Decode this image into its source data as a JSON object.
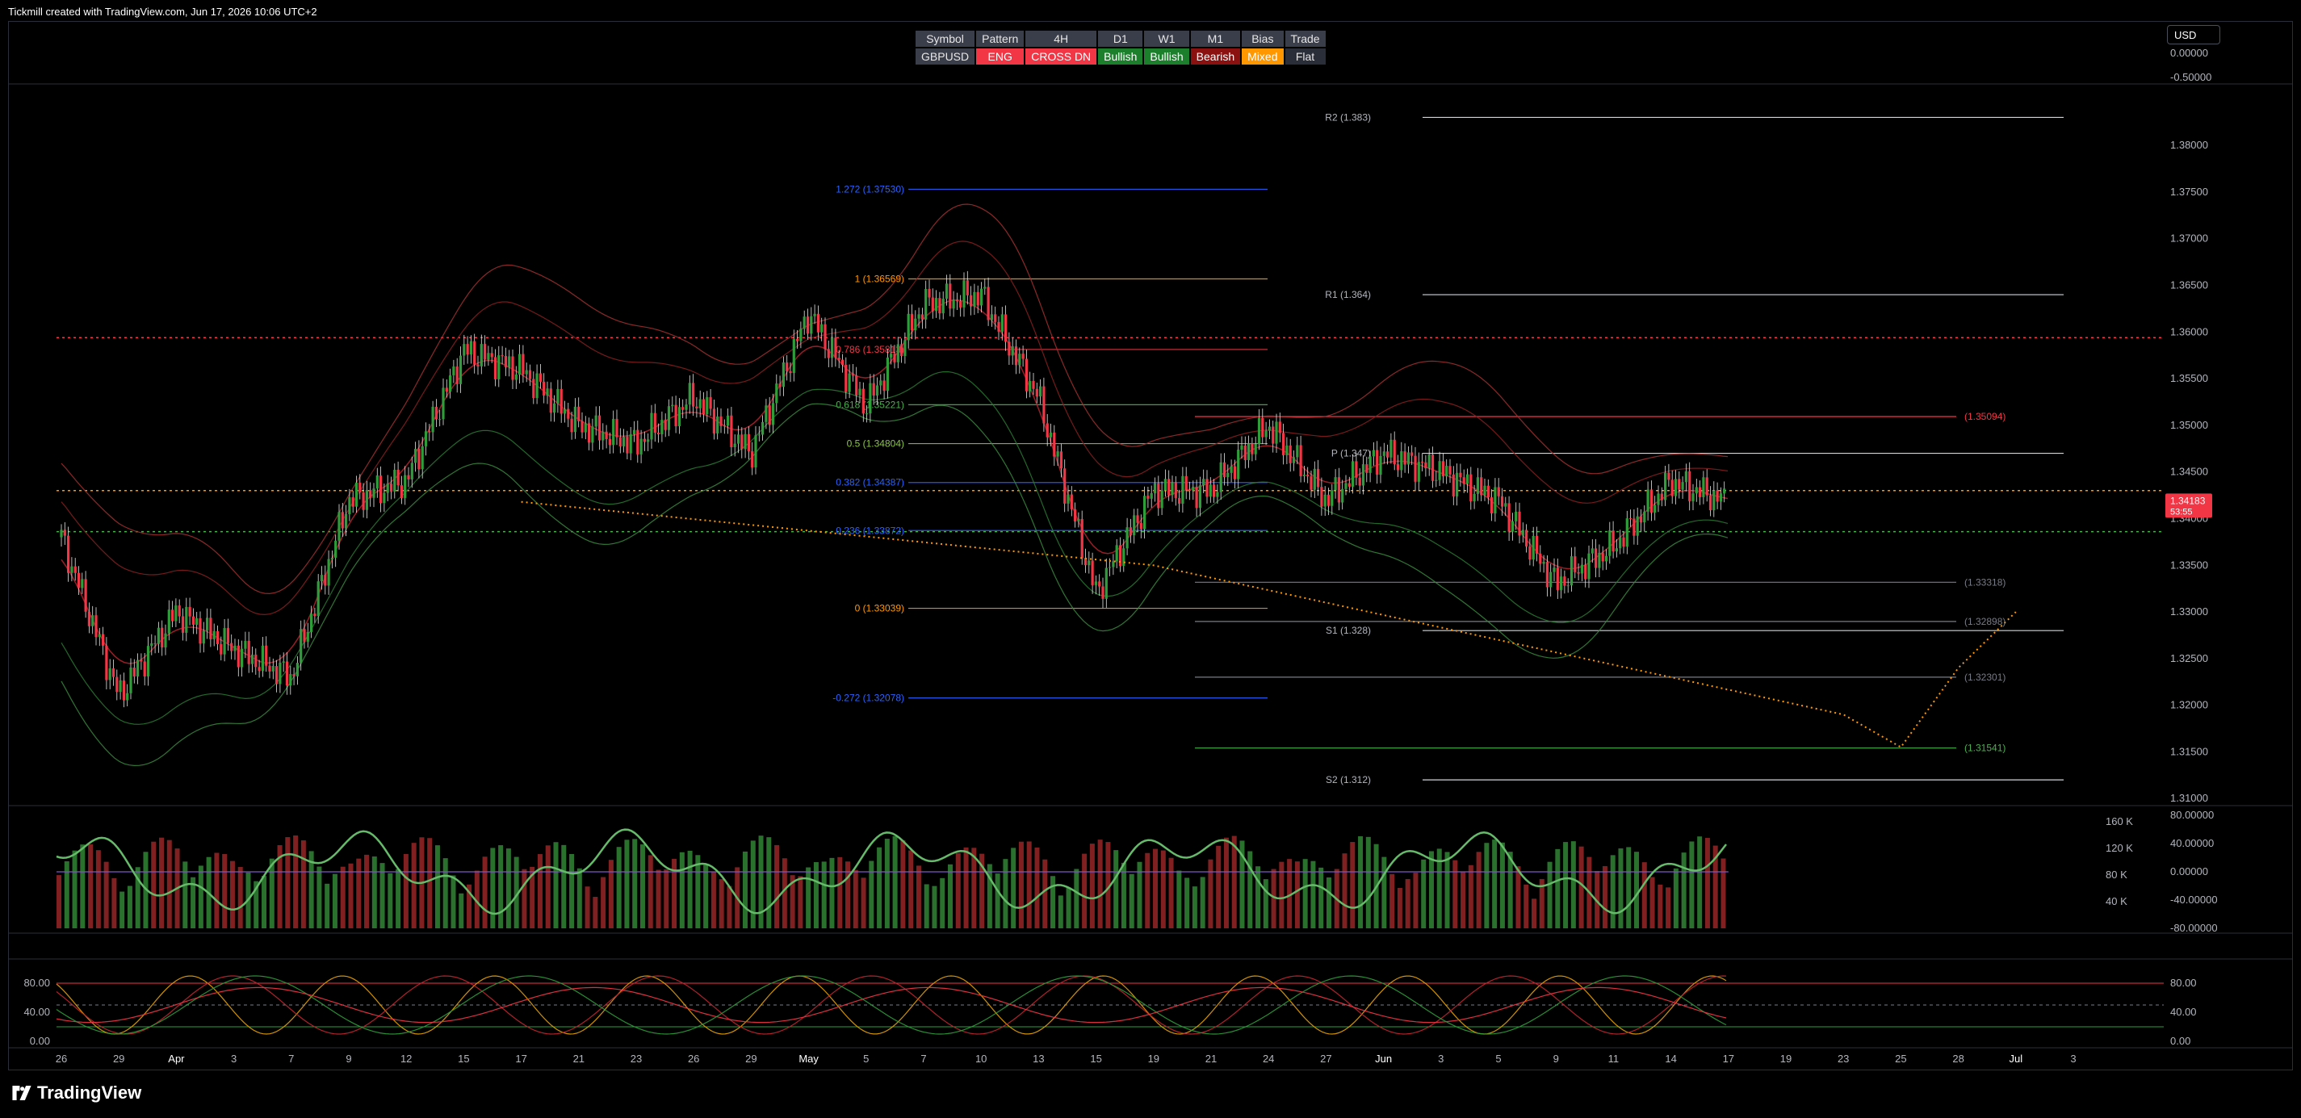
{
  "header": {
    "attribution": "Tickmill created with TradingView.com, Jun 17, 2026 10:06 UTC+2"
  },
  "currency_button": "USD",
  "summary_table": {
    "headers": [
      "Symbol",
      "Pattern",
      "4H",
      "D1",
      "W1",
      "M1",
      "Bias",
      "Trade"
    ],
    "row": [
      {
        "text": "GBPUSD",
        "style": "c-sym"
      },
      {
        "text": "ENG",
        "style": "c-red"
      },
      {
        "text": "CROSS DN",
        "style": "c-red"
      },
      {
        "text": "Bullish",
        "style": "c-green"
      },
      {
        "text": "Bullish",
        "style": "c-green"
      },
      {
        "text": "Bearish",
        "style": "c-darkred"
      },
      {
        "text": "Mixed",
        "style": "c-orange"
      },
      {
        "text": "Flat",
        "style": "c-gray"
      }
    ]
  },
  "footer": {
    "brand": "TradingView"
  },
  "colors": {
    "up": "#26a69a",
    "candle_up": "#2e9d3a",
    "candle_down": "#f23645",
    "fib": "#2962ff",
    "accent": "#ff9800"
  },
  "chart_data": {
    "type": "candlestick",
    "symbol": "GBPUSD",
    "timeframe": "4H",
    "last_price": "1.34183",
    "countdown": "53:55",
    "price_axis": {
      "ylim": [
        1.3095,
        1.3865
      ],
      "ticks": [
        "1.38000",
        "1.37500",
        "1.37000",
        "1.36500",
        "1.36000",
        "1.35500",
        "1.35000",
        "1.34500",
        "1.34000",
        "1.33500",
        "1.33000",
        "1.32500",
        "1.32000",
        "1.31500",
        "1.31000"
      ],
      "top_ticks": [
        "0.00000",
        "-0.50000"
      ]
    },
    "time_axis": [
      "26",
      "29",
      "Apr",
      "3",
      "7",
      "9",
      "12",
      "15",
      "17",
      "21",
      "23",
      "26",
      "29",
      "May",
      "5",
      "7",
      "10",
      "13",
      "15",
      "19",
      "21",
      "24",
      "27",
      "Jun",
      "3",
      "5",
      "9",
      "11",
      "14",
      "17",
      "19",
      "23",
      "25",
      "28",
      "Jul",
      "3"
    ],
    "key_points": [
      {
        "date": "26",
        "price": 1.338
      },
      {
        "date": "29",
        "price": 1.321
      },
      {
        "date": "Apr",
        "price": 1.33
      },
      {
        "date": "3",
        "price": 1.326
      },
      {
        "date": "7",
        "price": 1.323
      },
      {
        "date": "9",
        "price": 1.342
      },
      {
        "date": "12",
        "price": 1.344
      },
      {
        "date": "15",
        "price": 1.358
      },
      {
        "date": "17",
        "price": 1.356
      },
      {
        "date": "21",
        "price": 1.35
      },
      {
        "date": "23",
        "price": 1.348
      },
      {
        "date": "26",
        "price": 1.353
      },
      {
        "date": "29",
        "price": 1.347
      },
      {
        "date": "May",
        "price": 1.362
      },
      {
        "date": "5",
        "price": 1.352
      },
      {
        "date": "7",
        "price": 1.363
      },
      {
        "date": "10",
        "price": 1.364
      },
      {
        "date": "13",
        "price": 1.353
      },
      {
        "date": "15",
        "price": 1.332
      },
      {
        "date": "19",
        "price": 1.343
      },
      {
        "date": "21",
        "price": 1.343
      },
      {
        "date": "24",
        "price": 1.35
      },
      {
        "date": "27",
        "price": 1.342
      },
      {
        "date": "Jun",
        "price": 1.347
      },
      {
        "date": "3",
        "price": 1.345
      },
      {
        "date": "5",
        "price": 1.342
      },
      {
        "date": "9",
        "price": 1.333
      },
      {
        "date": "11",
        "price": 1.337
      },
      {
        "date": "14",
        "price": 1.344
      },
      {
        "date": "17",
        "price": 1.3418
      }
    ],
    "fib_levels": [
      {
        "label": "1.272 (1.37530)",
        "price": 1.3753,
        "color": "#2962ff"
      },
      {
        "label": "1 (1.36569)",
        "price": 1.36569,
        "color": "#ff9800"
      },
      {
        "label": "0.786 (1.35813)",
        "price": 1.35813,
        "color": "#f23645"
      },
      {
        "label": "0.618 (1.35221)",
        "price": 1.35221,
        "color": "#4caf50"
      },
      {
        "label": "0.5 (1.34804)",
        "price": 1.34804,
        "color": "#8bc34a"
      },
      {
        "label": "0.382 (1.34387)",
        "price": 1.34387,
        "color": "#2962ff"
      },
      {
        "label": "0.236 (1.33872)",
        "price": 1.33872,
        "color": "#2962ff"
      },
      {
        "label": "0 (1.33039)",
        "price": 1.33039,
        "color": "#ff9800"
      },
      {
        "label": "-0.272 (1.32078)",
        "price": 1.32078,
        "color": "#2962ff"
      }
    ],
    "pivot_levels": [
      {
        "label": "R2 (1.383)",
        "price": 1.383
      },
      {
        "label": "R1 (1.364)",
        "price": 1.364
      },
      {
        "label": "P (1.347)",
        "price": 1.347
      },
      {
        "label": "S1 (1.328)",
        "price": 1.328
      },
      {
        "label": "S2 (1.312)",
        "price": 1.312
      }
    ],
    "target_levels": [
      {
        "label": "(1.35094)",
        "price": 1.35094,
        "color": "#f23645"
      },
      {
        "label": "(1.33318)",
        "price": 1.33318,
        "color": "#787b86"
      },
      {
        "label": "(1.32898)",
        "price": 1.32898,
        "color": "#787b86"
      },
      {
        "label": "(1.32301)",
        "price": 1.32301,
        "color": "#787b86"
      },
      {
        "label": "(1.31541)",
        "price": 1.31541,
        "color": "#4caf50"
      }
    ],
    "horizontal_lines": [
      {
        "price": 1.3594,
        "color": "#f23645"
      },
      {
        "price": 1.343,
        "color": "#ff9800"
      },
      {
        "price": 1.3386,
        "color": "#4caf50"
      }
    ],
    "projection": [
      {
        "date": "17",
        "price": 1.3418
      },
      {
        "date": "19",
        "price": 1.335
      },
      {
        "date": "23",
        "price": 1.319
      },
      {
        "date": "25",
        "price": 1.3155
      },
      {
        "date": "28",
        "price": 1.324
      },
      {
        "date": "Jul",
        "price": 1.33
      }
    ],
    "volume_panel": {
      "right_ticks": [
        "80.00000",
        "40.00000",
        "0.00000",
        "-40.00000",
        "-80.00000"
      ],
      "volume_ticks": [
        "160 K",
        "120 K",
        "80 K",
        "40 K"
      ]
    },
    "stoch_panel": {
      "ticks": [
        "80.00",
        "40.00",
        "0.00"
      ],
      "right_ticks": [
        "80.00",
        "40.00",
        "0.00"
      ]
    }
  }
}
